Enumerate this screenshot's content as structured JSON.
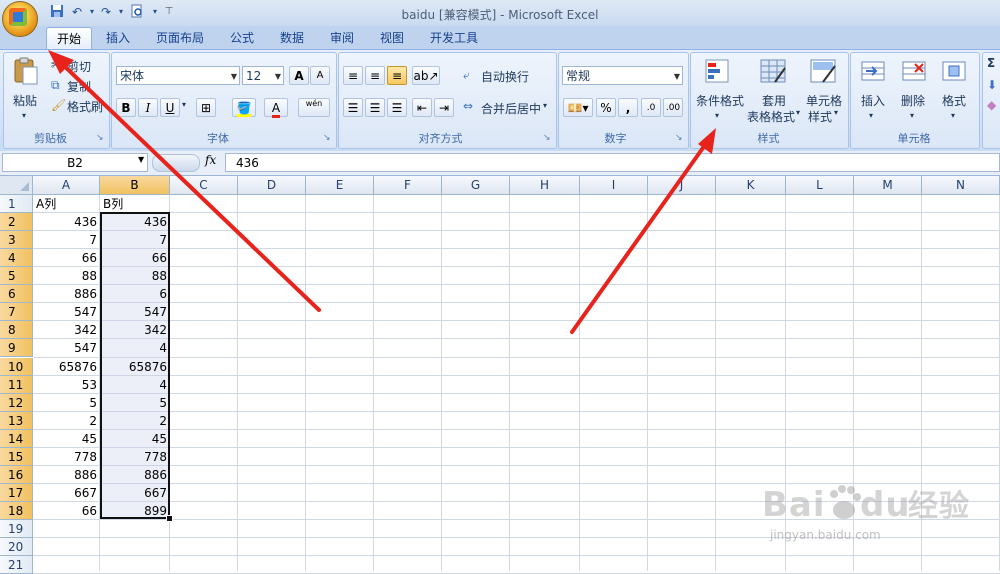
{
  "window": {
    "title": "baidu  [兼容模式] - Microsoft Excel"
  },
  "quick_access": {
    "save_icon": "save-icon",
    "undo_icon": "undo-icon",
    "redo_icon": "redo-icon",
    "preview_icon": "print-preview-icon"
  },
  "tabs": [
    "开始",
    "插入",
    "页面布局",
    "公式",
    "数据",
    "审阅",
    "视图",
    "开发工具"
  ],
  "ribbon": {
    "clipboard": {
      "paste": "粘贴",
      "cut": "剪切",
      "copy": "复制",
      "format_painter": "格式刷",
      "label": "剪贴板"
    },
    "font": {
      "name": "宋体",
      "size": "12",
      "grow": "A",
      "shrink": "A",
      "bold": "B",
      "italic": "I",
      "underline": "U",
      "phonetic": "wén",
      "label": "字体"
    },
    "alignment": {
      "wrap_text": "自动换行",
      "merge_center": "合并后居中",
      "label": "对齐方式"
    },
    "number": {
      "format": "常规",
      "percent": "%",
      "comma": ",",
      "label": "数字"
    },
    "styles": {
      "conditional_format": "条件格式",
      "table_format_1": "套用",
      "table_format_2": "表格格式",
      "cell_styles_1": "单元格",
      "cell_styles_2": "样式",
      "label": "样式"
    },
    "cells": {
      "insert": "插入",
      "delete": "删除",
      "format": "格式",
      "label": "单元格"
    },
    "editing": {
      "sigma": "Σ"
    }
  },
  "formula_bar": {
    "name_box": "B2",
    "fx": "fx",
    "content": "436"
  },
  "columns": [
    "A",
    "B",
    "C",
    "D",
    "E",
    "F",
    "G",
    "H",
    "I",
    "J",
    "K",
    "L",
    "M",
    "N"
  ],
  "rows": [
    "1",
    "2",
    "3",
    "4",
    "5",
    "6",
    "7",
    "8",
    "9",
    "10",
    "11",
    "12",
    "13",
    "14",
    "15",
    "16",
    "17",
    "18",
    "19",
    "20",
    "21"
  ],
  "cells": {
    "A1": "A列",
    "B1": "B列",
    "A": [
      "436",
      "7",
      "66",
      "88",
      "886",
      "547",
      "342",
      "547",
      "65876",
      "53",
      "5",
      "2",
      "45",
      "778",
      "886",
      "667",
      "66"
    ],
    "B": [
      "436",
      "7",
      "66",
      "88",
      "6",
      "547",
      "342",
      "4",
      "65876",
      "4",
      "5",
      "2",
      "45",
      "778",
      "886",
      "667",
      "899"
    ]
  },
  "selection": "B2:B18",
  "annotation_color": "#e8231c",
  "watermark": {
    "logo": "Baidu经验",
    "url": "jingyan.baidu.com"
  }
}
